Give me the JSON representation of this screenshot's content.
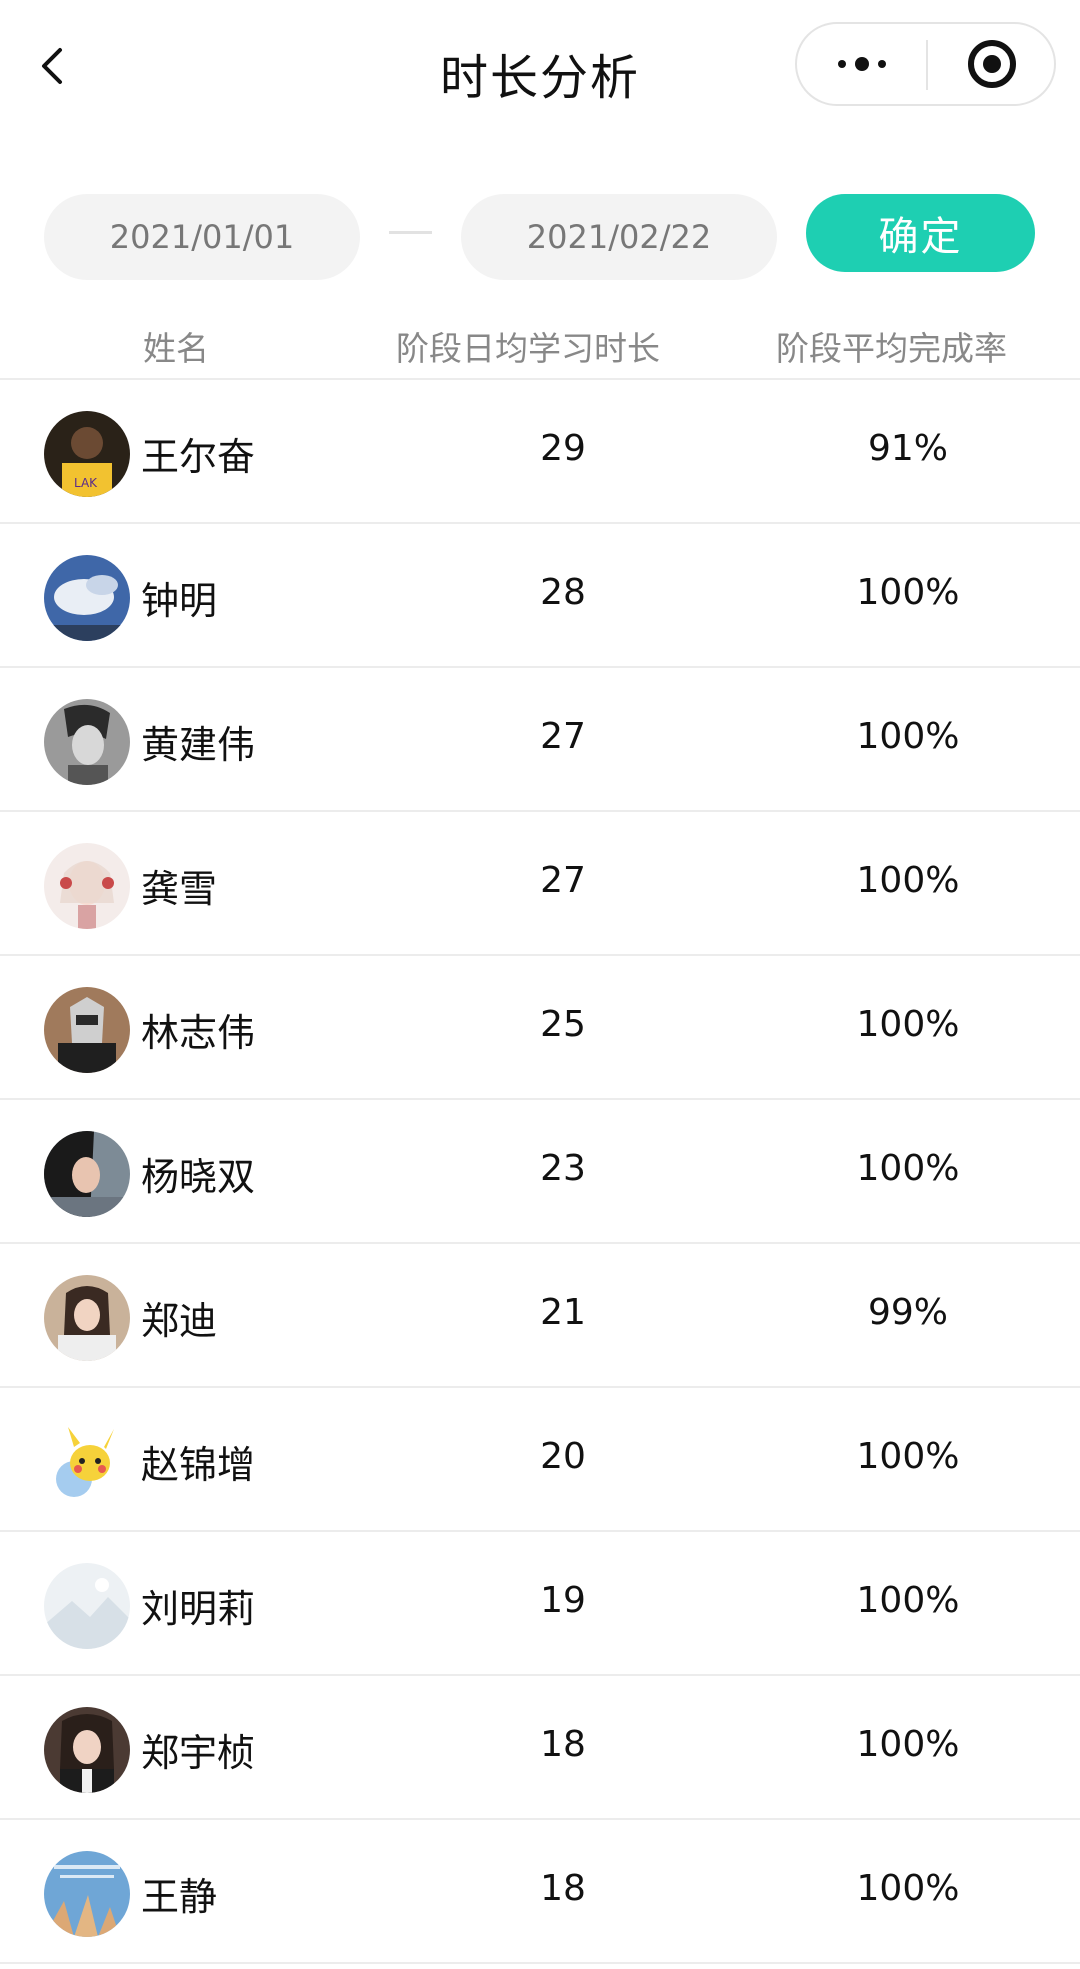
{
  "nav": {
    "title": "时长分析",
    "back_icon": "chevron-left-icon",
    "more_icon": "more-dots-icon",
    "close_icon": "record-circle-icon"
  },
  "filter": {
    "start_date": "2021/01/01",
    "end_date": "2021/02/22",
    "confirm_label": "确定",
    "accent_color": "#1ecfb2"
  },
  "table": {
    "headers": {
      "name": "姓名",
      "duration": "阶段日均学习时长",
      "rate": "阶段平均完成率"
    },
    "rows": [
      {
        "name": "王尔奋",
        "duration": "29",
        "rate": "91%"
      },
      {
        "name": "钟明",
        "duration": "28",
        "rate": "100%"
      },
      {
        "name": "黄建伟",
        "duration": "27",
        "rate": "100%"
      },
      {
        "name": "龚雪",
        "duration": "27",
        "rate": "100%"
      },
      {
        "name": "林志伟",
        "duration": "25",
        "rate": "100%"
      },
      {
        "name": "杨晓双",
        "duration": "23",
        "rate": "100%"
      },
      {
        "name": "郑迪",
        "duration": "21",
        "rate": "99%"
      },
      {
        "name": "赵锦增",
        "duration": "20",
        "rate": "100%"
      },
      {
        "name": "刘明莉",
        "duration": "19",
        "rate": "100%"
      },
      {
        "name": "郑宇桢",
        "duration": "18",
        "rate": "100%"
      },
      {
        "name": "王静",
        "duration": "18",
        "rate": "100%"
      }
    ]
  }
}
